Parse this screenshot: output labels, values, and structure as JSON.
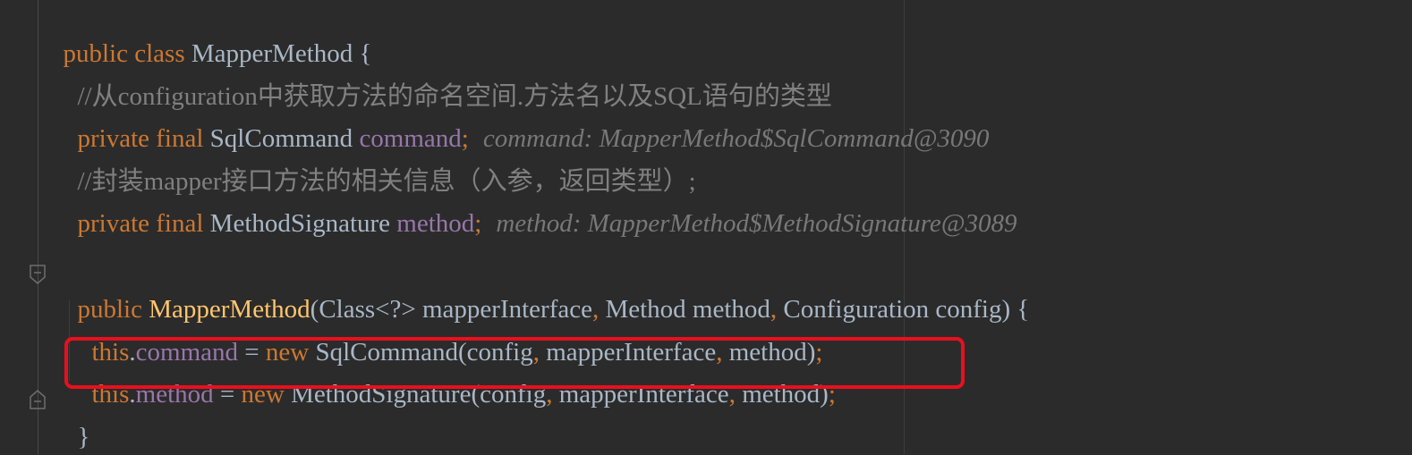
{
  "code": {
    "l1": {
      "kw": "public class ",
      "cls": "MapperMethod",
      "rest": " {"
    },
    "l2": {
      "comment": "//从configuration中获取方法的命名空间.方法名以及SQL语句的类型"
    },
    "l3": {
      "kw": "private final ",
      "type": "SqlCommand ",
      "field": "command",
      "semi": ";",
      "hint": "command: MapperMethod$SqlCommand@3090"
    },
    "l4": {
      "comment": "//封装mapper接口方法的相关信息（入参，返回类型）;"
    },
    "l5": {
      "kw": "private final ",
      "type": "MethodSignature ",
      "field": "method",
      "semi": ";",
      "hint": "method: MapperMethod$MethodSignature@3089"
    },
    "l6": {
      "kw": "public ",
      "fn": "MapperMethod",
      "p1": "(Class<?> mapperInterface",
      "c1": ",",
      "p2": " Method method",
      "c2": ",",
      "p3": " Configuration config) {"
    },
    "l7": {
      "this": "this",
      "dot": ".",
      "field": "command",
      "eq": " = ",
      "new": "new ",
      "ctor": "SqlCommand(config",
      "c1": ",",
      "a2": " mapperInterface",
      "c2": ",",
      "a3": " method)",
      "semi": ";"
    },
    "l8": {
      "this": "this",
      "dot": ".",
      "field": "method",
      "eq": " = ",
      "new": "new ",
      "ctor": "MethodSignature(config",
      "c1": ",",
      "a2": " mapperInterface",
      "c2": ",",
      "a3": " method)",
      "semi": ";"
    },
    "l9": {
      "brace": "}"
    }
  },
  "colors": {
    "background": "#2b2b2b",
    "keyword": "#cc7832",
    "field": "#9876aa",
    "function": "#ffc66d",
    "comment": "#808080",
    "highlight": "#e8101e"
  }
}
